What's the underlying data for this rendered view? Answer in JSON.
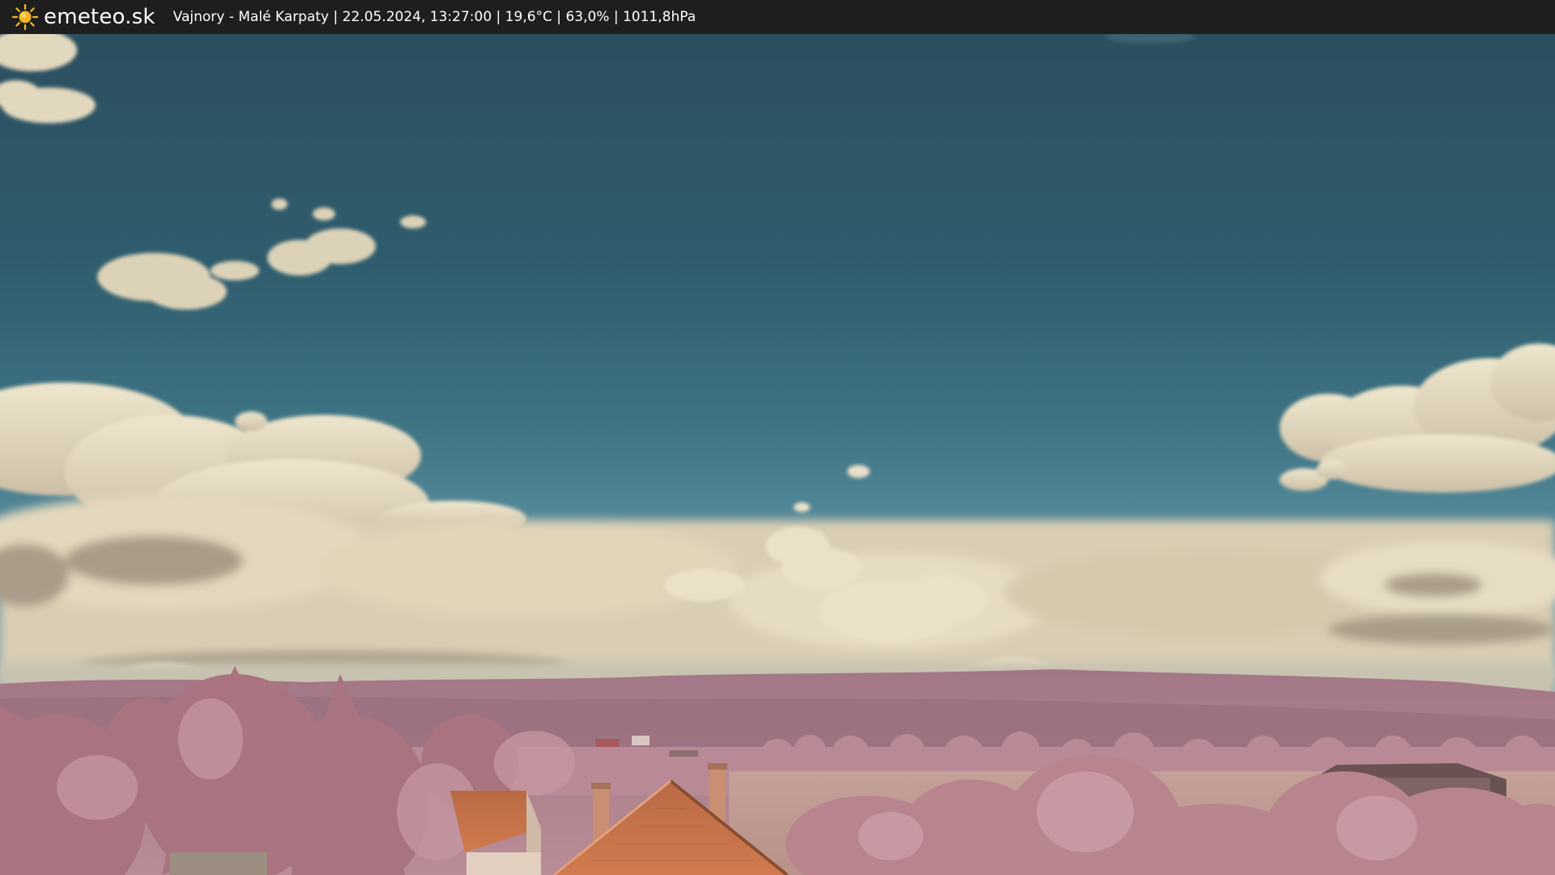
{
  "overlay": {
    "logo_icon": "sun-icon",
    "logo_text": "emeteo.sk",
    "info_line": "Vajnory - Malé Karpaty | 22.05.2024, 13:27:00 | 19,6°C | 63,0% | 1011,8hPa"
  },
  "colors": {
    "bar_background": "#1e1e1e",
    "sun": "#f5b823",
    "sky_top": "#2f5464",
    "sky_horizon": "#5f93a4",
    "cloud": "#e6dcc1",
    "foliage": "#b7838f",
    "hills": "#9f7380",
    "roof": "#c9673f"
  }
}
